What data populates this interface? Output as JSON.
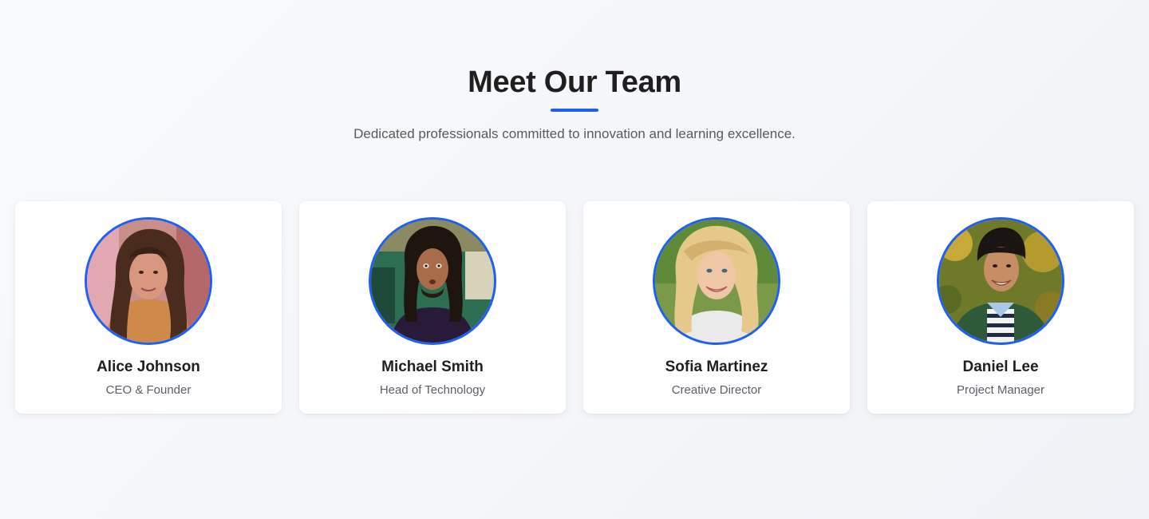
{
  "section": {
    "title": "Meet Our Team",
    "subtitle": "Dedicated professionals committed to innovation and learning excellence.",
    "accent_color": "#1f5ff2"
  },
  "team": [
    {
      "name": "Alice Johnson",
      "role": "CEO & Founder"
    },
    {
      "name": "Michael Smith",
      "role": "Head of Technology"
    },
    {
      "name": "Sofia Martinez",
      "role": "Creative Director"
    },
    {
      "name": "Daniel Lee",
      "role": "Project Manager"
    }
  ]
}
